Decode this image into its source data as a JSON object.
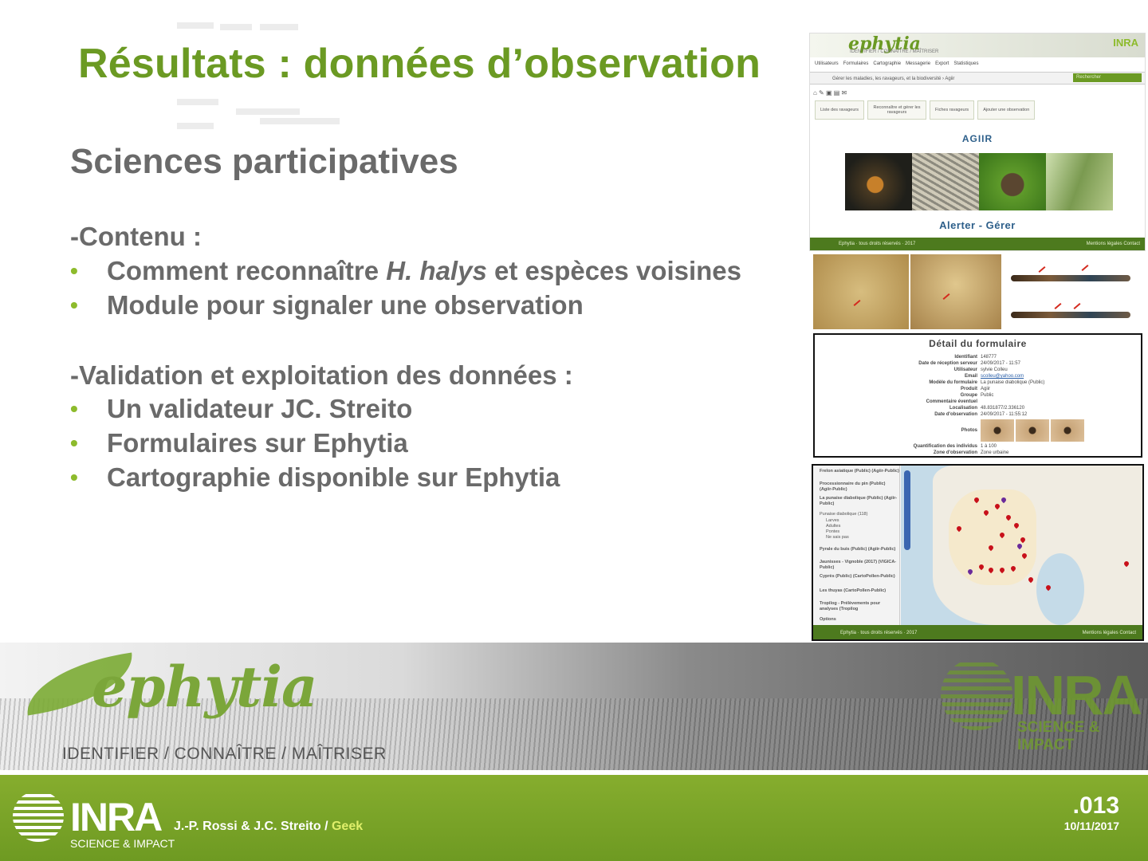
{
  "slide": {
    "title": "Résultats : données d’observation",
    "subtitle": "Sciences participatives",
    "section1": "-Contenu :",
    "bullets1": [
      {
        "pre": "Comment reconnaître ",
        "italic": "H. halys",
        "post": " et espèces voisines"
      },
      {
        "text": "Module pour signaler une observation"
      }
    ],
    "section2": "-Validation et exploitation des données :",
    "bullets2": [
      "Un validateur JC. Streito",
      "Formulaires sur Ephytia",
      "Cartographie disponible sur Ephytia"
    ],
    "bullet_color": "#8dbb2c",
    "title_color": "#6b9a23"
  },
  "site_shot": {
    "logo": "ephytia",
    "tagline": "IDENTIFIER / CONNAÎTRE / MAÎTRISER",
    "inra": "INRA",
    "menu": [
      "Utilisateurs",
      "Formulaires",
      "Cartographie",
      "Messagerie",
      "Export",
      "Statistiques"
    ],
    "breadcrumb": "Gérer les maladies, les ravageurs, et la biodiversité › Agiir",
    "search_placeholder": "Rechercher",
    "tabs": [
      "Liste des ravageurs",
      "Reconnaître et gérer les ravageurs",
      "Fiches ravageurs",
      "Ajouter une observation"
    ],
    "heading": "AGIIR",
    "cta": "Alerter - Gérer",
    "footer_left": "Ephytia · tous droits réservés · 2017",
    "footer_right": "Mentions légales    Contact"
  },
  "form_detail": {
    "heading": "Détail du formulaire",
    "rows": [
      {
        "k": "Identifiant",
        "v": "148777"
      },
      {
        "k": "Date de réception serveur",
        "v": "24/09/2017 - 11:57"
      },
      {
        "k": "Utilisateur",
        "v": "sylvie Colleu"
      },
      {
        "k": "Email",
        "v": "scolleu@yahoo.com",
        "link": true
      },
      {
        "k": "Modèle du formulaire",
        "v": "La punaise diabolique (Public)"
      },
      {
        "k": "Produit",
        "v": "Agiir"
      },
      {
        "k": "Groupe",
        "v": "Public"
      },
      {
        "k": "Commentaire éventuel",
        "v": ""
      },
      {
        "k": "Localisation",
        "v": "48.831877/2.336120"
      },
      {
        "k": "Date d'observation",
        "v": "24/09/2017 - 11:55:12"
      }
    ],
    "photos_label": "Photos",
    "rows2": [
      {
        "k": "Quantification des individus",
        "v": "1 à 100"
      },
      {
        "k": "Zone d'observation",
        "v": "Zone urbaine"
      }
    ]
  },
  "map_shot": {
    "layers": [
      "Frelon asiatique (Public) (Agiir-Public)",
      "Processionnaire du pin (Public) (Agiir-Public)",
      "La punaise diabolique (Public) (Agiir-Public)",
      "Punaise diabolique (118)",
      "Larves",
      "Adultes",
      "Pontes",
      "Ne sais pas",
      "Pyrale du buis (Public) (Agiir-Public)",
      "Jaunisses - Vignoble (2017) (VIGICA-Public)",
      "Cyprès (Public) (CartoPollen-Public)",
      "Les thuyas (CartoPollen-Public)",
      "Tropilog - Prélèvements pour analyses (Tropilog",
      "Options"
    ],
    "footer_left": "Ephytia · tous droits réservés · 2017",
    "footer_right": "Mentions légales    Contact"
  },
  "banner": {
    "brand": "ephytia",
    "tagline": "IDENTIFIER / CONNAÎTRE / MAÎTRISER",
    "inra": "INRA",
    "inra_sub": "SCIENCE & IMPACT"
  },
  "footer": {
    "inra": "INRA",
    "inra_sub": "SCIENCE & IMPACT",
    "authors": "J.-P. Rossi & J.C. Streito / ",
    "geek": "Geek",
    "page": ".013",
    "date": "10/11/2017"
  }
}
